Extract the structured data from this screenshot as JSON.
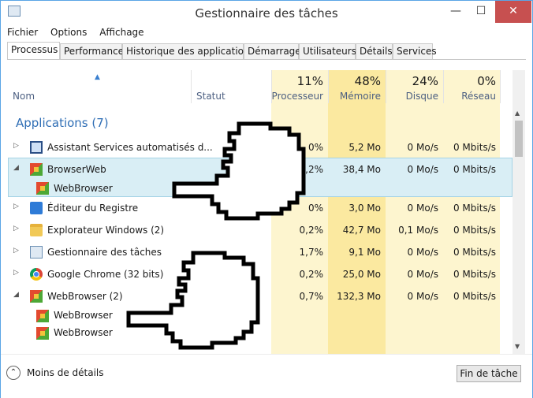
{
  "window": {
    "title": "Gestionnaire des tâches",
    "minimize": "—",
    "maximize": "☐",
    "close": "✕"
  },
  "menu": [
    "Fichier",
    "Options",
    "Affichage"
  ],
  "tabs": [
    "Processus",
    "Performance",
    "Historique des applications",
    "Démarrage",
    "Utilisateurs",
    "Détails",
    "Services"
  ],
  "columns": {
    "name": "Nom",
    "status": "Statut",
    "cpu": {
      "pct": "11%",
      "label": "Processeur"
    },
    "memory": {
      "pct": "48%",
      "label": "Mémoire"
    },
    "disk": {
      "pct": "24%",
      "label": "Disque"
    },
    "network": {
      "pct": "0%",
      "label": "Réseau"
    }
  },
  "group_header": "Applications (7)",
  "rows": [
    {
      "name": "Assistant Services automatisés d...",
      "cpu": "0%",
      "mem": "5,2 Mo",
      "disk": "0 Mo/s",
      "net": "0 Mbits/s",
      "icon": "monitor-icon",
      "expander": "▷"
    },
    {
      "name": "BrowserWeb",
      "cpu": "0,2%",
      "mem": "38,4 Mo",
      "disk": "0 Mo/s",
      "net": "0 Mbits/s",
      "icon": "webbrowser-icon",
      "expander": "◢",
      "selected": true
    },
    {
      "name": "WebBrowser",
      "child": true,
      "icon": "webbrowser-icon"
    },
    {
      "name": "Éditeur du Registre",
      "cpu": "0%",
      "mem": "3,0 Mo",
      "disk": "0 Mo/s",
      "net": "0 Mbits/s",
      "icon": "registry-icon",
      "expander": "▷"
    },
    {
      "name": "Explorateur Windows (2)",
      "cpu": "0,2%",
      "mem": "42,7 Mo",
      "disk": "0,1 Mo/s",
      "net": "0 Mbits/s",
      "icon": "folder-icon",
      "expander": "▷"
    },
    {
      "name": "Gestionnaire des tâches",
      "cpu": "1,7%",
      "mem": "9,1 Mo",
      "disk": "0 Mo/s",
      "net": "0 Mbits/s",
      "icon": "taskmanager-icon",
      "expander": "▷"
    },
    {
      "name": "Google Chrome (32 bits)",
      "cpu": "0,2%",
      "mem": "25,0 Mo",
      "disk": "0 Mo/s",
      "net": "0 Mbits/s",
      "icon": "chrome-icon",
      "expander": "▷"
    },
    {
      "name": "WebBrowser (2)",
      "cpu": "0,7%",
      "mem": "132,3 Mo",
      "disk": "0 Mo/s",
      "net": "0 Mbits/s",
      "icon": "webbrowser-icon",
      "expander": "◢"
    },
    {
      "name": "WebBrowser",
      "child": true,
      "icon": "webbrowser-icon"
    },
    {
      "name": "WebBrowser",
      "child": true,
      "icon": "webbrowser-icon"
    }
  ],
  "footer": {
    "fewer_details": "Moins de détails",
    "end_task": "Fin de tâche"
  }
}
